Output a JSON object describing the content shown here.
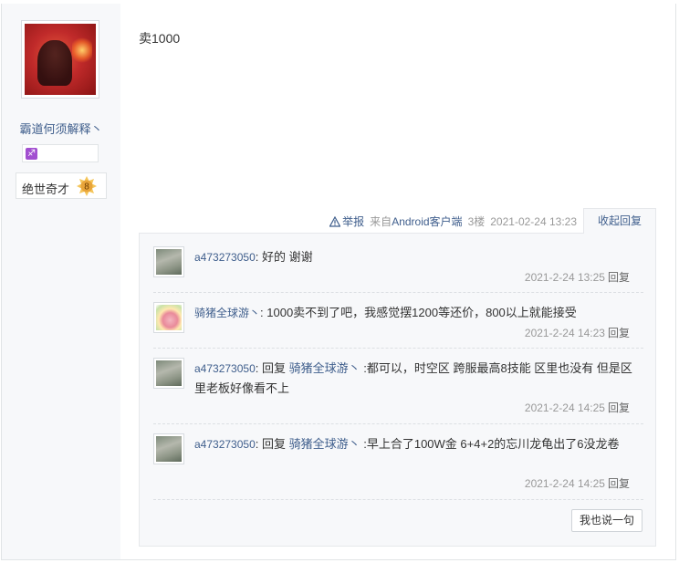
{
  "author": {
    "username": "霸道何须解释丶",
    "level_name": "绝世奇才",
    "level": "8",
    "zodiac_symbol": "♐"
  },
  "post": {
    "content": "卖1000",
    "report_label": "举报",
    "source": "来自",
    "source_link": "Android客户端",
    "floor": "3楼",
    "timestamp": "2021-02-24 13:23",
    "collapse_label": "收起回复"
  },
  "replies": [
    {
      "user": "a473273050",
      "separator": ":",
      "reply_word": "",
      "target": "",
      "text": " 好的 谢谢",
      "time": "2021-2-24 13:25",
      "reply_label": "回复"
    },
    {
      "user": "骑猪全球游丶",
      "separator": ":",
      "reply_word": "",
      "target": "",
      "text": " 1000卖不到了吧，我感觉摆1200等还价，800以上就能接受",
      "time": "2021-2-24 14:23",
      "reply_label": "回复"
    },
    {
      "user": "a473273050",
      "separator": ":",
      "reply_word": " 回复 ",
      "target": "骑猪全球游丶",
      "text": " :都可以，时空区 跨服最高8技能 区里也没有 但是区里老板好像看不上",
      "time": "2021-2-24 14:25",
      "reply_label": "回复"
    },
    {
      "user": "a473273050",
      "separator": ":",
      "reply_word": " 回复 ",
      "target": "骑猪全球游丶",
      "text": " :早上合了100W金 6+4+2的忘川龙龟出了6没龙卷",
      "time": "2021-2-24 14:25",
      "reply_label": "回复"
    }
  ],
  "say_button": "我也说一句",
  "colors": {
    "link": "#3f5e8c",
    "muted": "#999999",
    "panel_bg": "#f7f8fa",
    "badge": "#e8b84a",
    "zodiac": "#a24fd0"
  }
}
